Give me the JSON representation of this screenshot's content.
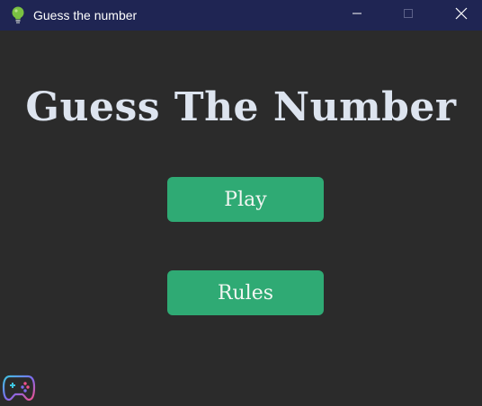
{
  "window": {
    "title": "Guess the number",
    "app_icon": "lightbulb-icon",
    "controls": [
      "minimize-icon",
      "maximize-icon",
      "close-icon"
    ]
  },
  "main": {
    "heading": "Guess The Number",
    "buttons": {
      "play_label": "Play",
      "rules_label": "Rules"
    },
    "corner_icon": "gamepad-icon"
  },
  "colors": {
    "titlebar": "#1f2553",
    "background": "#2b2b2b",
    "button": "#2faa74",
    "heading": "#dde4ef"
  }
}
